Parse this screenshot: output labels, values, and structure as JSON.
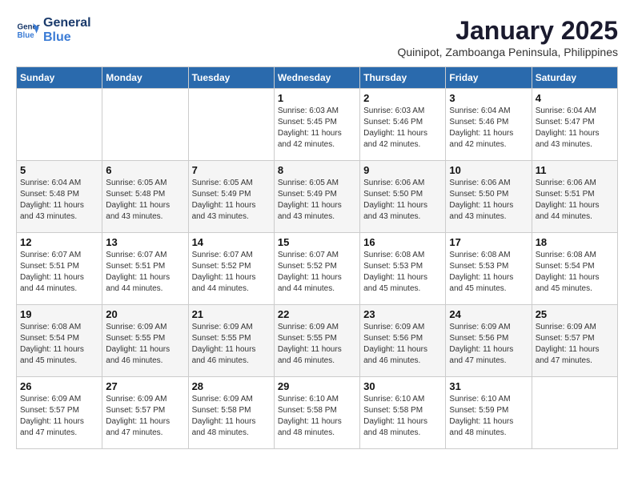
{
  "header": {
    "logo_line1": "General",
    "logo_line2": "Blue",
    "month_year": "January 2025",
    "location": "Quinipot, Zamboanga Peninsula, Philippines"
  },
  "weekdays": [
    "Sunday",
    "Monday",
    "Tuesday",
    "Wednesday",
    "Thursday",
    "Friday",
    "Saturday"
  ],
  "weeks": [
    [
      {
        "day": "",
        "info": ""
      },
      {
        "day": "",
        "info": ""
      },
      {
        "day": "",
        "info": ""
      },
      {
        "day": "1",
        "info": "Sunrise: 6:03 AM\nSunset: 5:45 PM\nDaylight: 11 hours\nand 42 minutes."
      },
      {
        "day": "2",
        "info": "Sunrise: 6:03 AM\nSunset: 5:46 PM\nDaylight: 11 hours\nand 42 minutes."
      },
      {
        "day": "3",
        "info": "Sunrise: 6:04 AM\nSunset: 5:46 PM\nDaylight: 11 hours\nand 42 minutes."
      },
      {
        "day": "4",
        "info": "Sunrise: 6:04 AM\nSunset: 5:47 PM\nDaylight: 11 hours\nand 43 minutes."
      }
    ],
    [
      {
        "day": "5",
        "info": "Sunrise: 6:04 AM\nSunset: 5:48 PM\nDaylight: 11 hours\nand 43 minutes."
      },
      {
        "day": "6",
        "info": "Sunrise: 6:05 AM\nSunset: 5:48 PM\nDaylight: 11 hours\nand 43 minutes."
      },
      {
        "day": "7",
        "info": "Sunrise: 6:05 AM\nSunset: 5:49 PM\nDaylight: 11 hours\nand 43 minutes."
      },
      {
        "day": "8",
        "info": "Sunrise: 6:05 AM\nSunset: 5:49 PM\nDaylight: 11 hours\nand 43 minutes."
      },
      {
        "day": "9",
        "info": "Sunrise: 6:06 AM\nSunset: 5:50 PM\nDaylight: 11 hours\nand 43 minutes."
      },
      {
        "day": "10",
        "info": "Sunrise: 6:06 AM\nSunset: 5:50 PM\nDaylight: 11 hours\nand 43 minutes."
      },
      {
        "day": "11",
        "info": "Sunrise: 6:06 AM\nSunset: 5:51 PM\nDaylight: 11 hours\nand 44 minutes."
      }
    ],
    [
      {
        "day": "12",
        "info": "Sunrise: 6:07 AM\nSunset: 5:51 PM\nDaylight: 11 hours\nand 44 minutes."
      },
      {
        "day": "13",
        "info": "Sunrise: 6:07 AM\nSunset: 5:51 PM\nDaylight: 11 hours\nand 44 minutes."
      },
      {
        "day": "14",
        "info": "Sunrise: 6:07 AM\nSunset: 5:52 PM\nDaylight: 11 hours\nand 44 minutes."
      },
      {
        "day": "15",
        "info": "Sunrise: 6:07 AM\nSunset: 5:52 PM\nDaylight: 11 hours\nand 44 minutes."
      },
      {
        "day": "16",
        "info": "Sunrise: 6:08 AM\nSunset: 5:53 PM\nDaylight: 11 hours\nand 45 minutes."
      },
      {
        "day": "17",
        "info": "Sunrise: 6:08 AM\nSunset: 5:53 PM\nDaylight: 11 hours\nand 45 minutes."
      },
      {
        "day": "18",
        "info": "Sunrise: 6:08 AM\nSunset: 5:54 PM\nDaylight: 11 hours\nand 45 minutes."
      }
    ],
    [
      {
        "day": "19",
        "info": "Sunrise: 6:08 AM\nSunset: 5:54 PM\nDaylight: 11 hours\nand 45 minutes."
      },
      {
        "day": "20",
        "info": "Sunrise: 6:09 AM\nSunset: 5:55 PM\nDaylight: 11 hours\nand 46 minutes."
      },
      {
        "day": "21",
        "info": "Sunrise: 6:09 AM\nSunset: 5:55 PM\nDaylight: 11 hours\nand 46 minutes."
      },
      {
        "day": "22",
        "info": "Sunrise: 6:09 AM\nSunset: 5:55 PM\nDaylight: 11 hours\nand 46 minutes."
      },
      {
        "day": "23",
        "info": "Sunrise: 6:09 AM\nSunset: 5:56 PM\nDaylight: 11 hours\nand 46 minutes."
      },
      {
        "day": "24",
        "info": "Sunrise: 6:09 AM\nSunset: 5:56 PM\nDaylight: 11 hours\nand 47 minutes."
      },
      {
        "day": "25",
        "info": "Sunrise: 6:09 AM\nSunset: 5:57 PM\nDaylight: 11 hours\nand 47 minutes."
      }
    ],
    [
      {
        "day": "26",
        "info": "Sunrise: 6:09 AM\nSunset: 5:57 PM\nDaylight: 11 hours\nand 47 minutes."
      },
      {
        "day": "27",
        "info": "Sunrise: 6:09 AM\nSunset: 5:57 PM\nDaylight: 11 hours\nand 47 minutes."
      },
      {
        "day": "28",
        "info": "Sunrise: 6:09 AM\nSunset: 5:58 PM\nDaylight: 11 hours\nand 48 minutes."
      },
      {
        "day": "29",
        "info": "Sunrise: 6:10 AM\nSunset: 5:58 PM\nDaylight: 11 hours\nand 48 minutes."
      },
      {
        "day": "30",
        "info": "Sunrise: 6:10 AM\nSunset: 5:58 PM\nDaylight: 11 hours\nand 48 minutes."
      },
      {
        "day": "31",
        "info": "Sunrise: 6:10 AM\nSunset: 5:59 PM\nDaylight: 11 hours\nand 48 minutes."
      },
      {
        "day": "",
        "info": ""
      }
    ]
  ]
}
